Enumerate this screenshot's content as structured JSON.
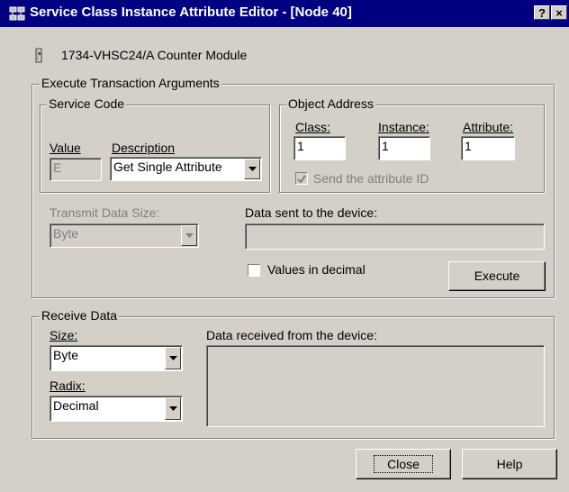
{
  "window": {
    "title": "Service Class Instance Attribute Editor - [Node 40]",
    "help_button": "?",
    "close_button": "×"
  },
  "device": {
    "name": "1734-VHSC24/A Counter Module",
    "icon": "device-module-icon"
  },
  "execute_group": {
    "label": "Execute Transaction Arguments",
    "service_code": {
      "label": "Service Code",
      "value_label": "Value",
      "value": "E",
      "description_label": "Description",
      "description": "Get Single Attribute"
    },
    "object_address": {
      "label": "Object Address",
      "class_label": "Class:",
      "class_value": "1",
      "instance_label": "Instance:",
      "instance_value": "1",
      "attribute_label": "Attribute:",
      "attribute_value": "1",
      "send_attr_label": "Send the attribute ID",
      "send_attr_checked": true
    },
    "transmit_size_label": "Transmit Data Size:",
    "transmit_size_value": "Byte",
    "data_sent_label": "Data sent to the device:",
    "data_sent_value": "",
    "values_decimal_label": "Values in decimal",
    "values_decimal_checked": false,
    "execute_label": "Execute"
  },
  "receive_group": {
    "label": "Receive Data",
    "size_label": "Size:",
    "size_value": "Byte",
    "radix_label": "Radix:",
    "radix_value": "Decimal",
    "data_received_label": "Data received from the device:",
    "data_received_value": ""
  },
  "buttons": {
    "close": "Close",
    "help": "Help"
  }
}
